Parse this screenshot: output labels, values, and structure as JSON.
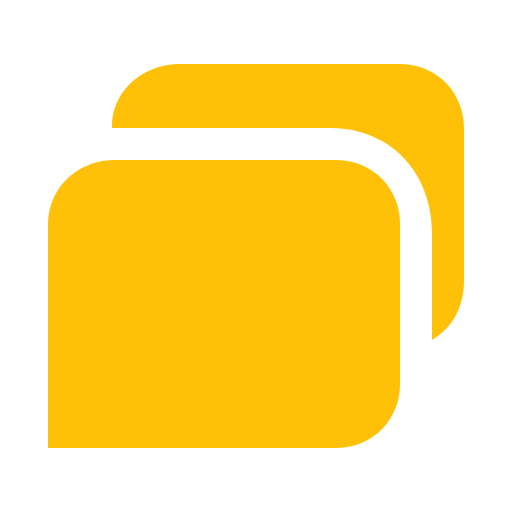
{
  "icon": {
    "name": "stacked-cards-icon",
    "color": "#FFC107",
    "background": "#FFFFFF"
  }
}
